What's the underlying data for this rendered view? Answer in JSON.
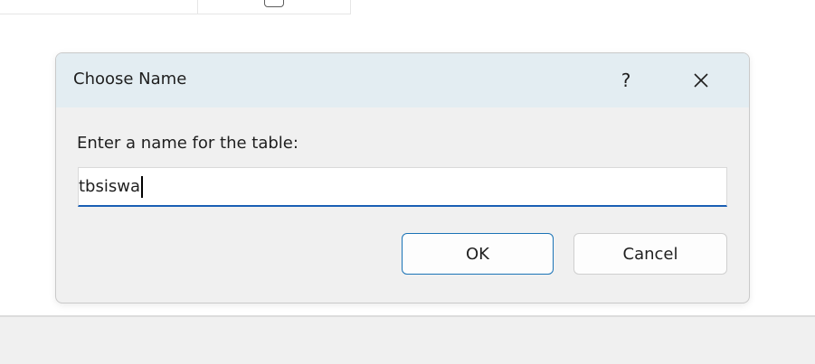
{
  "dialog": {
    "title": "Choose Name",
    "help_label": "?",
    "prompt_label": "Enter a name for the table:",
    "name_value": "tbsiswa",
    "ok_label": "OK",
    "cancel_label": "Cancel"
  },
  "colors": {
    "titlebar": "#e3edf2",
    "dialog_bg": "#f0f0f0",
    "accent": "#1a5fb4"
  },
  "icons": {
    "close": "close-icon",
    "help": "help-icon"
  }
}
